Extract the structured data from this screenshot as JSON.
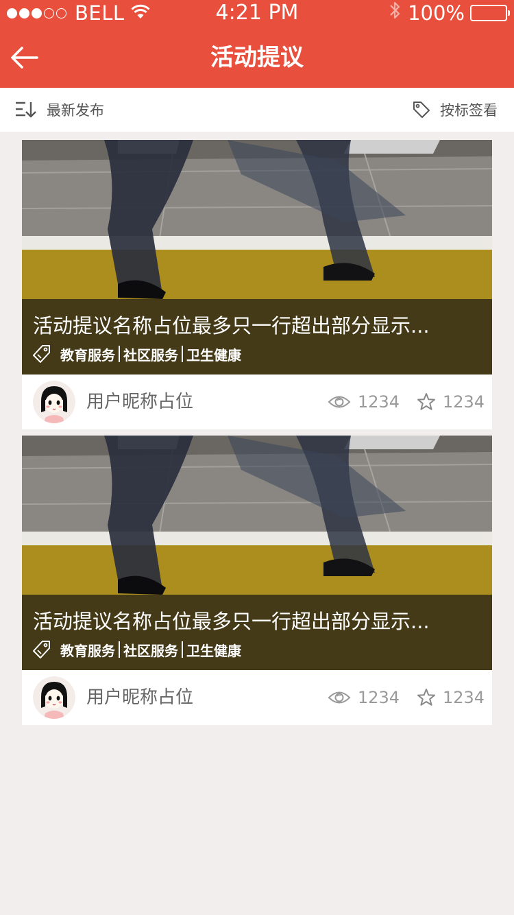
{
  "status_bar": {
    "carrier": "BELL",
    "time": "4:21 PM",
    "battery": "100%"
  },
  "nav": {
    "title": "活动提议"
  },
  "filter": {
    "sort_label": "最新发布",
    "tag_label": "按标签看"
  },
  "colors": {
    "accent": "#e8503d",
    "background": "#f2eeed"
  },
  "cards": [
    {
      "title": "活动提议名称占位最多只一行超出部分显示...",
      "tags": [
        "教育服务",
        "社区服务",
        "卫生健康"
      ],
      "user": "用户昵称占位",
      "views": "1234",
      "stars": "1234"
    },
    {
      "title": "活动提议名称占位最多只一行超出部分显示...",
      "tags": [
        "教育服务",
        "社区服务",
        "卫生健康"
      ],
      "user": "用户昵称占位",
      "views": "1234",
      "stars": "1234"
    }
  ]
}
